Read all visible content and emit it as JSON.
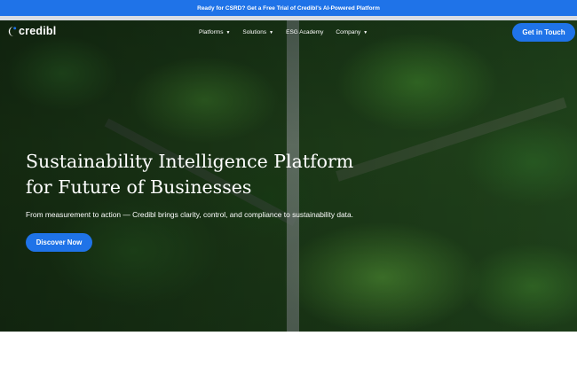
{
  "announcement": {
    "text": "Ready for CSRD? Get a Free Trial of Credibl's AI-Powered Platform"
  },
  "brand": {
    "name": "credibl",
    "logo_icon": "crescent-logo-icon"
  },
  "nav": {
    "items": [
      {
        "label": "Platforms",
        "has_dropdown": true
      },
      {
        "label": "Solutions",
        "has_dropdown": true
      },
      {
        "label": "ESG Academy",
        "has_dropdown": false
      },
      {
        "label": "Company",
        "has_dropdown": true
      }
    ],
    "dropdown_glyph": "▼",
    "cta_label": "Get in Touch"
  },
  "hero": {
    "title_line1": "Sustainability Intelligence Platform",
    "title_line2": "for Future of Businesses",
    "subtitle": "From measurement to action — Credibl brings clarity, control, and compliance to sustainability data.",
    "cta_label": "Discover Now",
    "background": "aerial-forest-image"
  },
  "colors": {
    "accent": "#1f73e8",
    "text_light": "#ffffff",
    "divider": "#d9dde3"
  }
}
